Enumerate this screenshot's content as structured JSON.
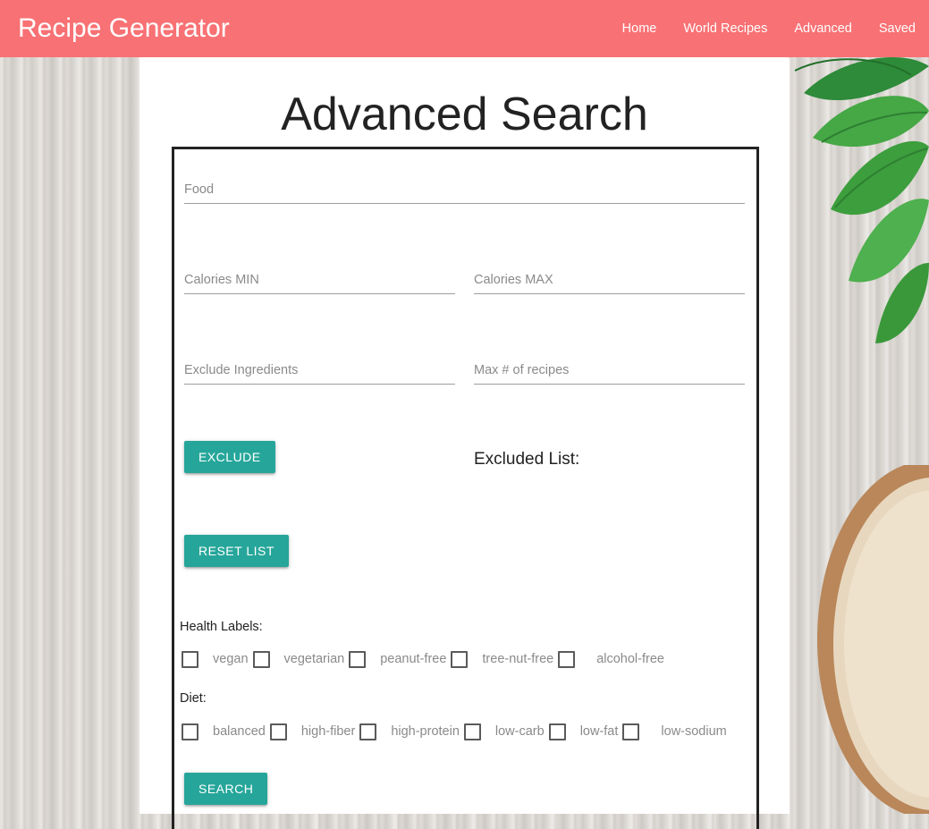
{
  "header": {
    "brand": "Recipe Generator",
    "nav": [
      "Home",
      "World Recipes",
      "Advanced",
      "Saved"
    ]
  },
  "page": {
    "title": "Advanced Search"
  },
  "form": {
    "food_placeholder": "Food",
    "calories_min_placeholder": "Calories MIN",
    "calories_max_placeholder": "Calories MAX",
    "exclude_placeholder": "Exclude Ingredients",
    "max_recipes_placeholder": "Max # of recipes",
    "exclude_button": "EXCLUDE",
    "excluded_heading": "Excluded List:",
    "reset_button": "RESET LIST",
    "health_label": "Health Labels:",
    "health_options": [
      "vegan",
      "vegetarian",
      "peanut-free",
      "tree-nut-free",
      "alcohol-free"
    ],
    "diet_label": "Diet:",
    "diet_options": [
      "balanced",
      "high-fiber",
      "high-protein",
      "low-carb",
      "low-fat",
      "low-sodium"
    ],
    "search_button": "SEARCH"
  },
  "colors": {
    "navbar": "#f87174",
    "button": "#26a69a"
  }
}
